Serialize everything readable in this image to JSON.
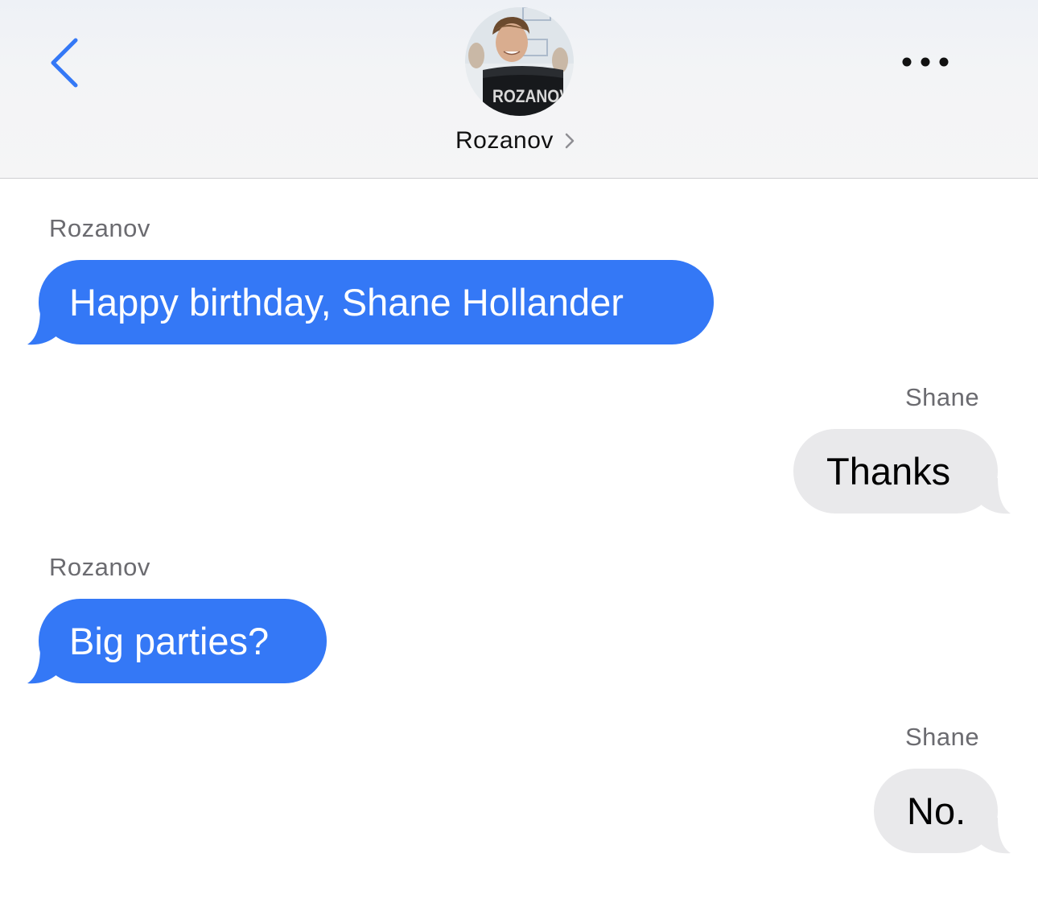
{
  "header": {
    "contact_name": "Rozanov",
    "avatar_jersey_text": "ROZANOV",
    "back_icon": "chevron-left-icon",
    "more_icon": "more-horizontal-icon",
    "chevron_icon": "chevron-right-icon"
  },
  "messages": [
    {
      "sender": "Rozanov",
      "text": "Happy birthday, Shane Hollander",
      "direction": "incoming"
    },
    {
      "sender": "Shane",
      "text": "Thanks",
      "direction": "outgoing"
    },
    {
      "sender": "Rozanov",
      "text": "Big parties?",
      "direction": "incoming"
    },
    {
      "sender": "Shane",
      "text": "No.",
      "direction": "outgoing"
    }
  ],
  "colors": {
    "incoming_bubble": "#3478f6",
    "outgoing_bubble": "#e9e9eb",
    "accent": "#3478f6"
  }
}
